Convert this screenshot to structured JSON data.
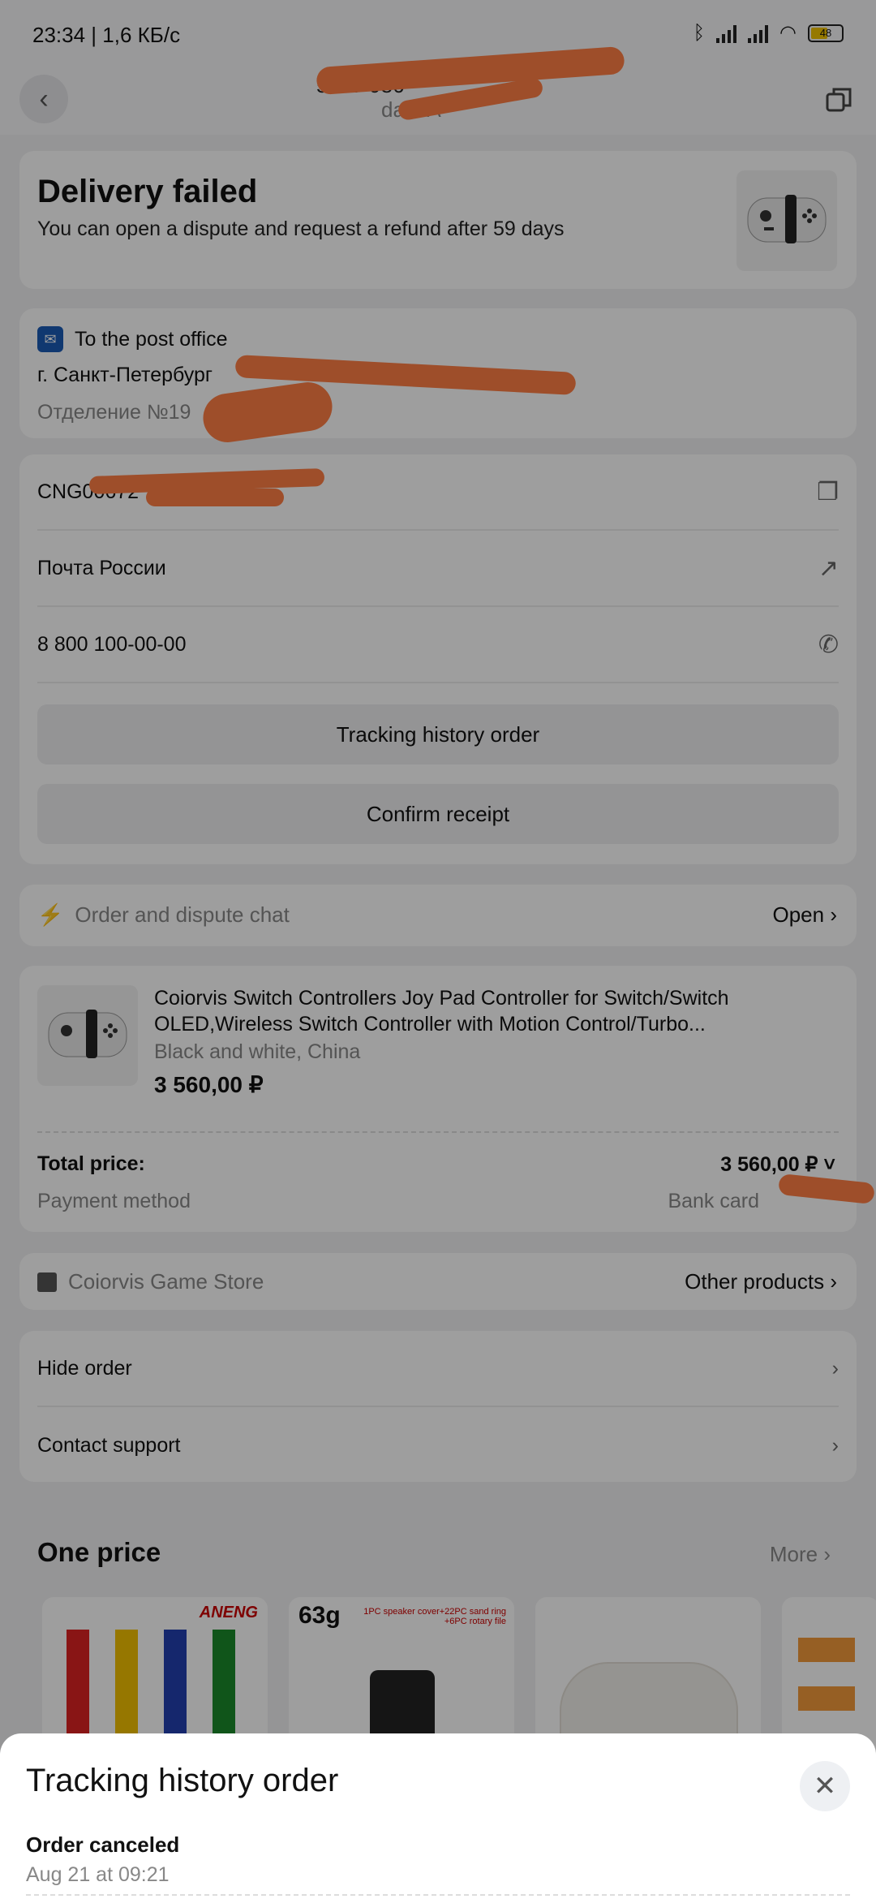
{
  "status_bar": {
    "time": "23:34 | 1,6 КБ/с",
    "battery": "48"
  },
  "header": {
    "order_number_partial": "5417 986",
    "date_partial": "date A"
  },
  "delivery": {
    "title": "Delivery failed",
    "subtitle": "You can open a dispute and request a refund after 59 days"
  },
  "address": {
    "method": "To the post office",
    "city": "г. Санкт-Петербург",
    "branch": "Отделение №19"
  },
  "tracking": {
    "number": "CNG00672",
    "carrier": "Почта России",
    "phone": "8 800 100-00-00",
    "history_button": "Tracking history order",
    "confirm_button": "Confirm receipt"
  },
  "chat": {
    "label": "Order and dispute chat",
    "action": "Open ›"
  },
  "product": {
    "name": "Coiorvis Switch Controllers Joy Pad Controller for Switch/Switch OLED,Wireless Switch Controller with Motion Control/Turbo...",
    "variant": "Black and white, China",
    "price": "3 560,00 ₽",
    "total_label": "Total price:",
    "total_value": "3 560,00 ₽ ˅",
    "payment_label": "Payment method",
    "payment_value": "Bank card"
  },
  "store": {
    "name": "Coiorvis Game Store",
    "action": "Other products ›"
  },
  "actions": {
    "hide_order": "Hide order",
    "contact_support": "Contact support"
  },
  "recommendations": {
    "title": "One price",
    "more": "More ›",
    "brand": "ANENG",
    "weight": "63g",
    "speaker_caption": "1PC speaker cover+22PC sand ring\n+6PC rotary file"
  },
  "sheet": {
    "title": "Tracking history order",
    "event_title": "Order canceled",
    "event_time": "Aug 21 at 09:21"
  },
  "colors": {
    "accent": "#e8742c",
    "scribble": "#ff7e45"
  }
}
